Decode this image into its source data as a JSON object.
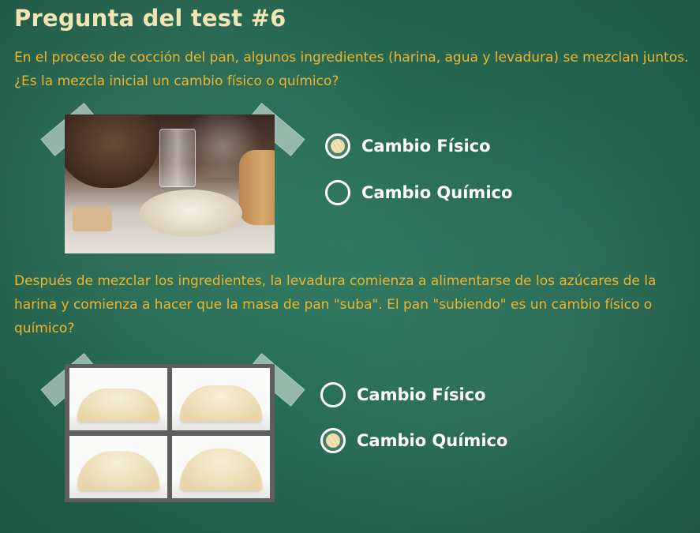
{
  "title": "Pregunta del test #6",
  "questions": [
    {
      "text": "En el proceso de cocción del pan, algunos ingredientes (harina, agua y levadura) se mezclan juntos. ¿Es la mezcla inicial un cambio físico o químico?",
      "options": [
        {
          "label": "Cambio Físico",
          "selected": true
        },
        {
          "label": "Cambio Químico",
          "selected": false
        }
      ]
    },
    {
      "text": "Después de mezclar los ingredientes, la levadura comienza a alimentarse de los azúcares de la harina y comienza a hacer que la masa de pan \"suba\". El pan \"subiendo\" es un cambio físico o químico?",
      "options": [
        {
          "label": "Cambio Físico",
          "selected": false
        },
        {
          "label": "Cambio Químico",
          "selected": true
        }
      ]
    }
  ],
  "colors": {
    "chalkboard": "#276b55",
    "title": "#f3e4b6",
    "question": "#f2b52a",
    "option": "#ffffff"
  }
}
